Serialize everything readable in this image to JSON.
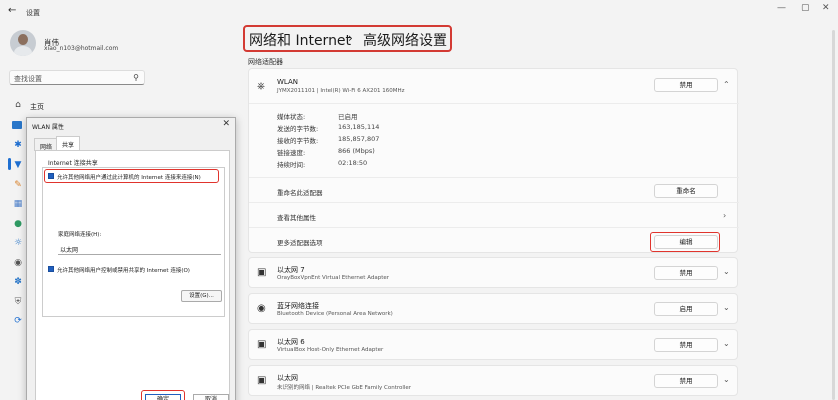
{
  "window": {
    "back": "←",
    "title": "设置",
    "minimize": "—",
    "maximize": "▢",
    "close": "✕"
  },
  "user": {
    "name": "肖伟",
    "email": "xiao_n103@hotmail.com"
  },
  "search": {
    "placeholder": "查找设置"
  },
  "nav": {
    "home": "主页"
  },
  "dialog": {
    "title": "WLAN 属性",
    "tabs": [
      "网络",
      "共享"
    ],
    "group_label": "Internet 连接共享",
    "allow_share": "允许其他网络用户通过此计算机的 Internet 连接来连接(N)",
    "home_conn_label": "家庭网络连接(H):",
    "home_conn_value": "以太网",
    "allow_control": "允许其他网络用户控制或禁用共享的 Internet 连接(O)",
    "settings_btn": "设置(G)...",
    "ok": "确定",
    "cancel": "取消"
  },
  "breadcrumb": {
    "part1": "网络和 Internet",
    "sep": "›",
    "part2": "高级网络设置"
  },
  "section": "网络适配器",
  "wlan": {
    "name": "WLAN",
    "desc": "JYMX2011101 | Intel(R) Wi-Fi 6 AX201 160MHz",
    "disable": "禁用",
    "props": [
      {
        "label": "媒体状态:",
        "value": "已启用"
      },
      {
        "label": "发送的字节数:",
        "value": "163,185,114"
      },
      {
        "label": "接收的字节数:",
        "value": "185,857,807"
      },
      {
        "label": "链接速度:",
        "value": "866 (Mbps)"
      },
      {
        "label": "持续时间:",
        "value": "02:18:50"
      }
    ],
    "rename_label": "重命名此适配器",
    "rename_btn": "重命名",
    "view_props": "查看其他属性",
    "more_options": "更多适配器选项",
    "edit_btn": "编辑"
  },
  "adapters": [
    {
      "name": "以太网 7",
      "desc": "OrayBoxVpnEnt Virtual Ethernet Adapter",
      "btn": "禁用"
    },
    {
      "name": "蓝牙网络连接",
      "desc": "Bluetooth Device (Personal Area Network)",
      "btn": "启用"
    },
    {
      "name": "以太网 6",
      "desc": "VirtualBox Host-Only Ethernet Adapter",
      "btn": "禁用"
    },
    {
      "name": "以太网",
      "desc": "未识别的网络 | Realtek PCIe GbE Family Controller",
      "btn": "禁用"
    }
  ]
}
